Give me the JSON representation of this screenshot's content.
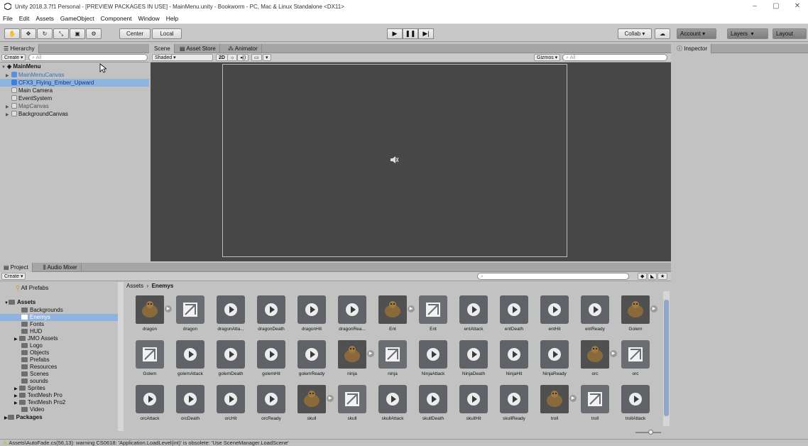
{
  "window": {
    "title": "Unity 2018.3.7f1 Personal - [PREVIEW PACKAGES IN USE] - MainMenu.unity - Bookworm - PC, Mac & Linux Standalone <DX11>",
    "controls": [
      "–",
      "▢",
      "✕"
    ]
  },
  "menu": [
    "File",
    "Edit",
    "Assets",
    "GameObject",
    "Component",
    "Window",
    "Help"
  ],
  "toolbar": {
    "tools": [
      "hand",
      "move",
      "rotate",
      "scale",
      "rect",
      "transform"
    ],
    "pivot_label": "Center",
    "space_label": "Local",
    "collab_label": "Collab ▾",
    "account_label": "Account",
    "layers_label": "Layers",
    "layout_label": "Layout"
  },
  "hierarchy": {
    "tab_label": "Hierarchy",
    "create_label": "Create ▾",
    "search_placeholder": "All",
    "scene_name": "MainMenu",
    "items": [
      {
        "label": "MainMenuCanvas",
        "color": "#3d6fb6"
      },
      {
        "label": "CFX3_Flying_Ember_Upward",
        "color": "#0a3a8c"
      },
      {
        "label": "Main Camera",
        "color": "#111"
      },
      {
        "label": "EventSystem",
        "color": "#111"
      },
      {
        "label": "MapCanvas",
        "color": "#555"
      },
      {
        "label": "BackgroundCanvas",
        "color": "#111"
      }
    ]
  },
  "scene": {
    "tabs": [
      "Scene",
      "Asset Store",
      "Animator"
    ],
    "shading": "Shaded",
    "mode_2d": "2D",
    "gizmos_label": "Gizmos ▾",
    "search_placeholder": "All"
  },
  "inspector": {
    "tab_label": "Inspector"
  },
  "project": {
    "tabs": [
      "Project",
      "Audio Mixer"
    ],
    "create_label": "Create ▾",
    "breadcrumb_root": "Assets",
    "breadcrumb_current": "Enemys",
    "favorites": [
      "All Prefabs"
    ],
    "assets_root": "Assets",
    "folders": [
      "Backgrounds",
      "Enemys",
      "Fonts",
      "HUD",
      "JMO Assets",
      "Logo",
      "Objects",
      "Prefabs",
      "Resources",
      "Scenes",
      "sounds",
      "Sprites",
      "TextMesh Pro",
      "TextMesh Pro2",
      "Video"
    ],
    "packages_label": "Packages",
    "assets": [
      {
        "name": "dragon",
        "kind": "sprite"
      },
      {
        "name": "dragon",
        "kind": "ctrl"
      },
      {
        "name": "dragonAtta...",
        "kind": "anim"
      },
      {
        "name": "dragonDeath",
        "kind": "anim"
      },
      {
        "name": "dragonHit",
        "kind": "anim"
      },
      {
        "name": "dragonRea...",
        "kind": "anim"
      },
      {
        "name": "Ent",
        "kind": "sprite"
      },
      {
        "name": "Ent",
        "kind": "ctrl"
      },
      {
        "name": "entAttack",
        "kind": "anim"
      },
      {
        "name": "entDeath",
        "kind": "anim"
      },
      {
        "name": "entHit",
        "kind": "anim"
      },
      {
        "name": "entReady",
        "kind": "anim"
      },
      {
        "name": "Golem",
        "kind": "sprite"
      },
      {
        "name": "Golem",
        "kind": "ctrl"
      },
      {
        "name": "golemAttack",
        "kind": "anim"
      },
      {
        "name": "golemDeath",
        "kind": "anim"
      },
      {
        "name": "golemHit",
        "kind": "anim"
      },
      {
        "name": "golemReady",
        "kind": "anim"
      },
      {
        "name": "ninja",
        "kind": "sprite"
      },
      {
        "name": "ninja",
        "kind": "ctrl"
      },
      {
        "name": "NinjaAttack",
        "kind": "anim"
      },
      {
        "name": "NinjaDeath",
        "kind": "anim"
      },
      {
        "name": "NinjaHit",
        "kind": "anim"
      },
      {
        "name": "NinjaReady",
        "kind": "anim"
      },
      {
        "name": "orc",
        "kind": "sprite"
      },
      {
        "name": "orc",
        "kind": "ctrl"
      },
      {
        "name": "orcAttack",
        "kind": "anim"
      },
      {
        "name": "orcDeath",
        "kind": "anim"
      },
      {
        "name": "orcHit",
        "kind": "anim"
      },
      {
        "name": "orcReady",
        "kind": "anim"
      },
      {
        "name": "skull",
        "kind": "sprite"
      },
      {
        "name": "skull",
        "kind": "ctrl"
      },
      {
        "name": "skullAttack",
        "kind": "anim"
      },
      {
        "name": "skullDeath",
        "kind": "anim"
      },
      {
        "name": "skullHit",
        "kind": "anim"
      },
      {
        "name": "skullReady",
        "kind": "anim"
      },
      {
        "name": "troll",
        "kind": "sprite"
      },
      {
        "name": "troll",
        "kind": "ctrl"
      },
      {
        "name": "trollAttack",
        "kind": "anim"
      }
    ]
  },
  "status": {
    "message": "Assets\\AutoFade.cs(56,13): warning CS0618: 'Application.LoadLevel(int)' is obsolete: 'Use SceneManager.LoadScene'"
  }
}
